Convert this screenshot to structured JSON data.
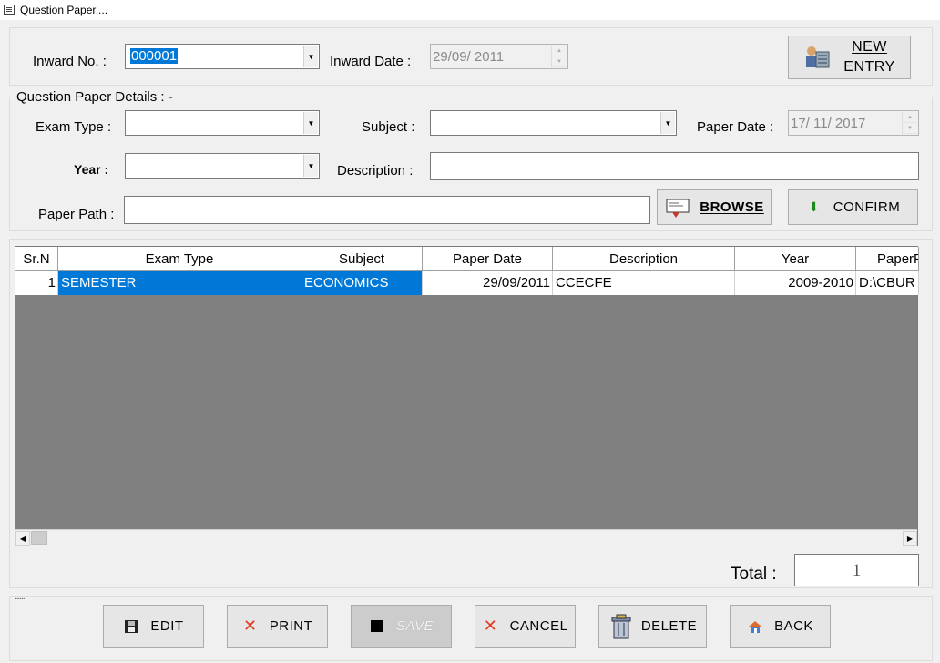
{
  "window": {
    "title": "Question Paper...."
  },
  "inward": {
    "no_label": "Inward No. :",
    "no_value": "000001",
    "date_label": "Inward Date :",
    "date_value": "29/09/ 2011"
  },
  "buttons": {
    "new_line1": "NEW",
    "new_line2": "ENTRY",
    "browse": "BROWSE",
    "confirm": "CONFIRM",
    "edit": "EDIT",
    "print": "PRINT",
    "save": "SAVE",
    "cancel": "CANCEL",
    "delete": "DELETE",
    "back": "BACK"
  },
  "details": {
    "group_label": "Question Paper Details : -",
    "exam_type_label": "Exam Type :",
    "exam_type_value": "",
    "subject_label": "Subject :",
    "subject_value": "",
    "paper_date_label": "Paper Date :",
    "paper_date_value": "17/ 11/ 2017",
    "year_label": "Year :",
    "year_value": "",
    "description_label": "Description :",
    "description_value": "",
    "paper_path_label": "Paper Path :",
    "paper_path_value": ""
  },
  "grid": {
    "columns": [
      "Sr.N",
      "Exam Type",
      "Subject",
      "Paper Date",
      "Description",
      "Year",
      "PaperP"
    ],
    "rows": [
      {
        "sr": "1",
        "exam_type": "SEMESTER",
        "subject": "ECONOMICS",
        "paper_date": "29/09/2011",
        "description": "CCECFE",
        "year": "2009-2010",
        "paper_path": "D:\\CBUR"
      }
    ]
  },
  "total": {
    "label": "Total :",
    "value": "1"
  },
  "footer": {
    "dots": "......"
  }
}
